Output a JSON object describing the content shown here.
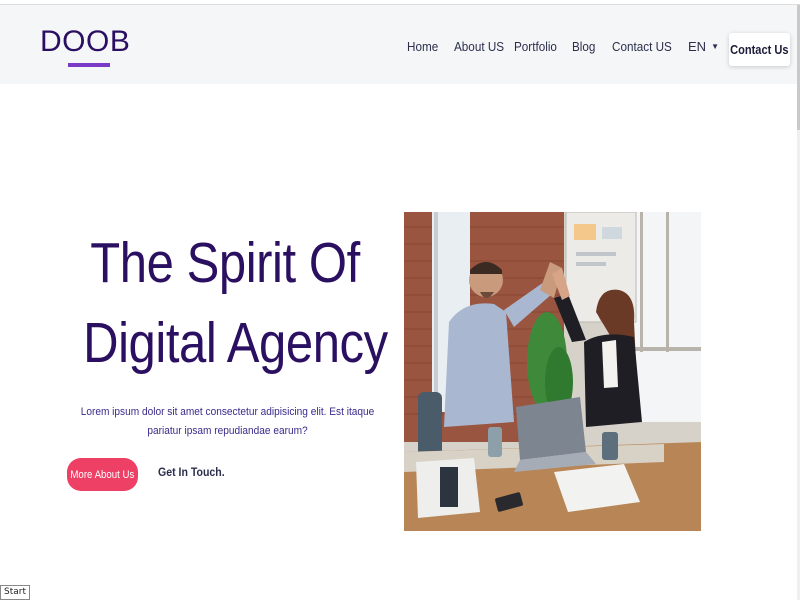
{
  "header": {
    "logo_text": "DOOB",
    "nav": {
      "home": "Home",
      "about": "About US",
      "portfolio": "Portfolio",
      "blog": "Blog",
      "contact": "Contact US",
      "language": "EN"
    },
    "contact_button": "Contact Us"
  },
  "hero": {
    "title_line1": "The Spirit Of",
    "title_line2": "Digital Agency .",
    "description": "Lorem ipsum dolor sit amet consectetur adipisicing elit. Est itaque pariatur ipsam repudiandae earum?",
    "primary_button": "More About Us",
    "secondary_link": "Get In Touch."
  },
  "footer": {
    "start_label": "Start"
  },
  "colors": {
    "brand_dark": "#2b0f61",
    "brand_accent": "#7a3cc8",
    "cta_pink": "#ee3f64",
    "header_bg": "#f5f6f8"
  },
  "icons": {
    "language_caret": "caret-down-icon"
  }
}
